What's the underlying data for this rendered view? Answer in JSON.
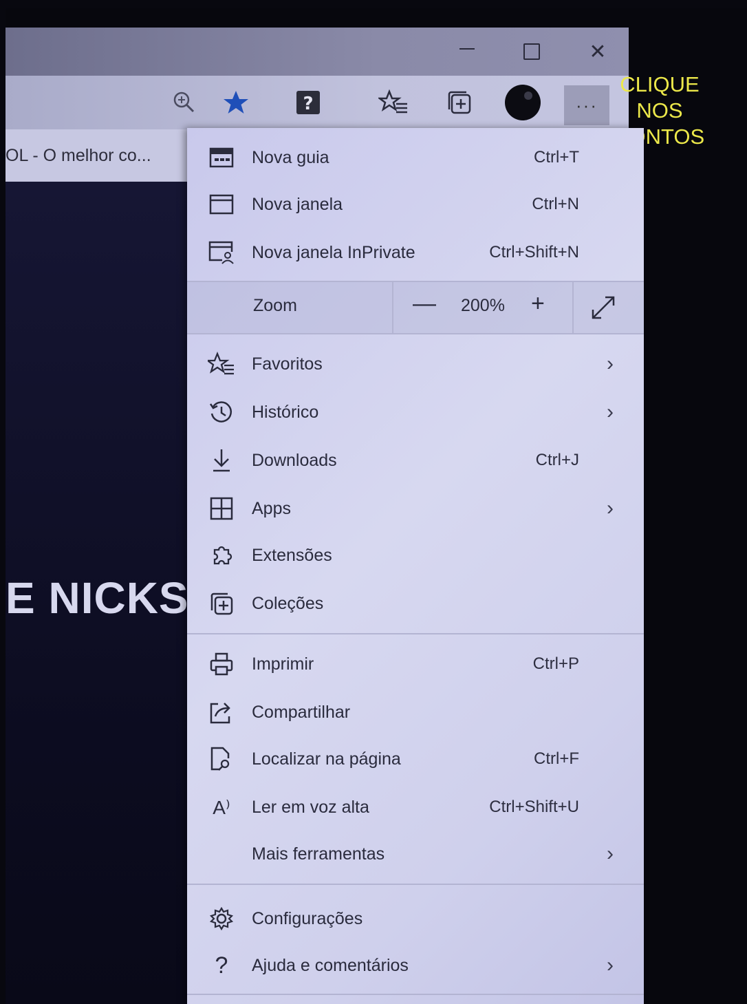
{
  "window": {
    "minimize_glyph": "—",
    "close_glyph": "✕"
  },
  "toolbar": {
    "more_label": "···",
    "icons": [
      "zoom-in-icon",
      "favorite-star-icon",
      "extension-help-icon",
      "favorites-list-icon",
      "collections-icon",
      "profile-avatar-icon",
      "more-dots-icon"
    ]
  },
  "tab": {
    "title": "OL - O melhor co..."
  },
  "page": {
    "heading_fragment": "E NICKS"
  },
  "annotation": {
    "line1": "CLIQUE",
    "line2": "NOS",
    "line3": "PONTOS",
    "color": "#ece84a"
  },
  "menu": {
    "new_tab": {
      "label": "Nova guia",
      "shortcut": "Ctrl+T"
    },
    "new_window": {
      "label": "Nova janela",
      "shortcut": "Ctrl+N"
    },
    "new_inprivate": {
      "label": "Nova janela InPrivate",
      "shortcut": "Ctrl+Shift+N"
    },
    "zoom": {
      "label": "Zoom",
      "minus": "—",
      "value": "200%",
      "plus": "+"
    },
    "favorites": {
      "label": "Favoritos",
      "chevron": "›"
    },
    "history": {
      "label": "Histórico",
      "chevron": "›"
    },
    "downloads": {
      "label": "Downloads",
      "shortcut": "Ctrl+J"
    },
    "apps": {
      "label": "Apps",
      "chevron": "›"
    },
    "extensions": {
      "label": "Extensões"
    },
    "collections": {
      "label": "Coleções"
    },
    "print": {
      "label": "Imprimir",
      "shortcut": "Ctrl+P"
    },
    "share": {
      "label": "Compartilhar"
    },
    "find": {
      "label": "Localizar na página",
      "shortcut": "Ctrl+F"
    },
    "read_aloud": {
      "label": "Ler em voz alta",
      "shortcut": "Ctrl+Shift+U",
      "icon_glyph": "A⁾"
    },
    "more_tools": {
      "label": "Mais ferramentas",
      "chevron": "›"
    },
    "settings": {
      "label": "Configurações"
    },
    "help": {
      "label": "Ajuda e comentários",
      "icon_glyph": "?",
      "chevron": "›"
    }
  }
}
